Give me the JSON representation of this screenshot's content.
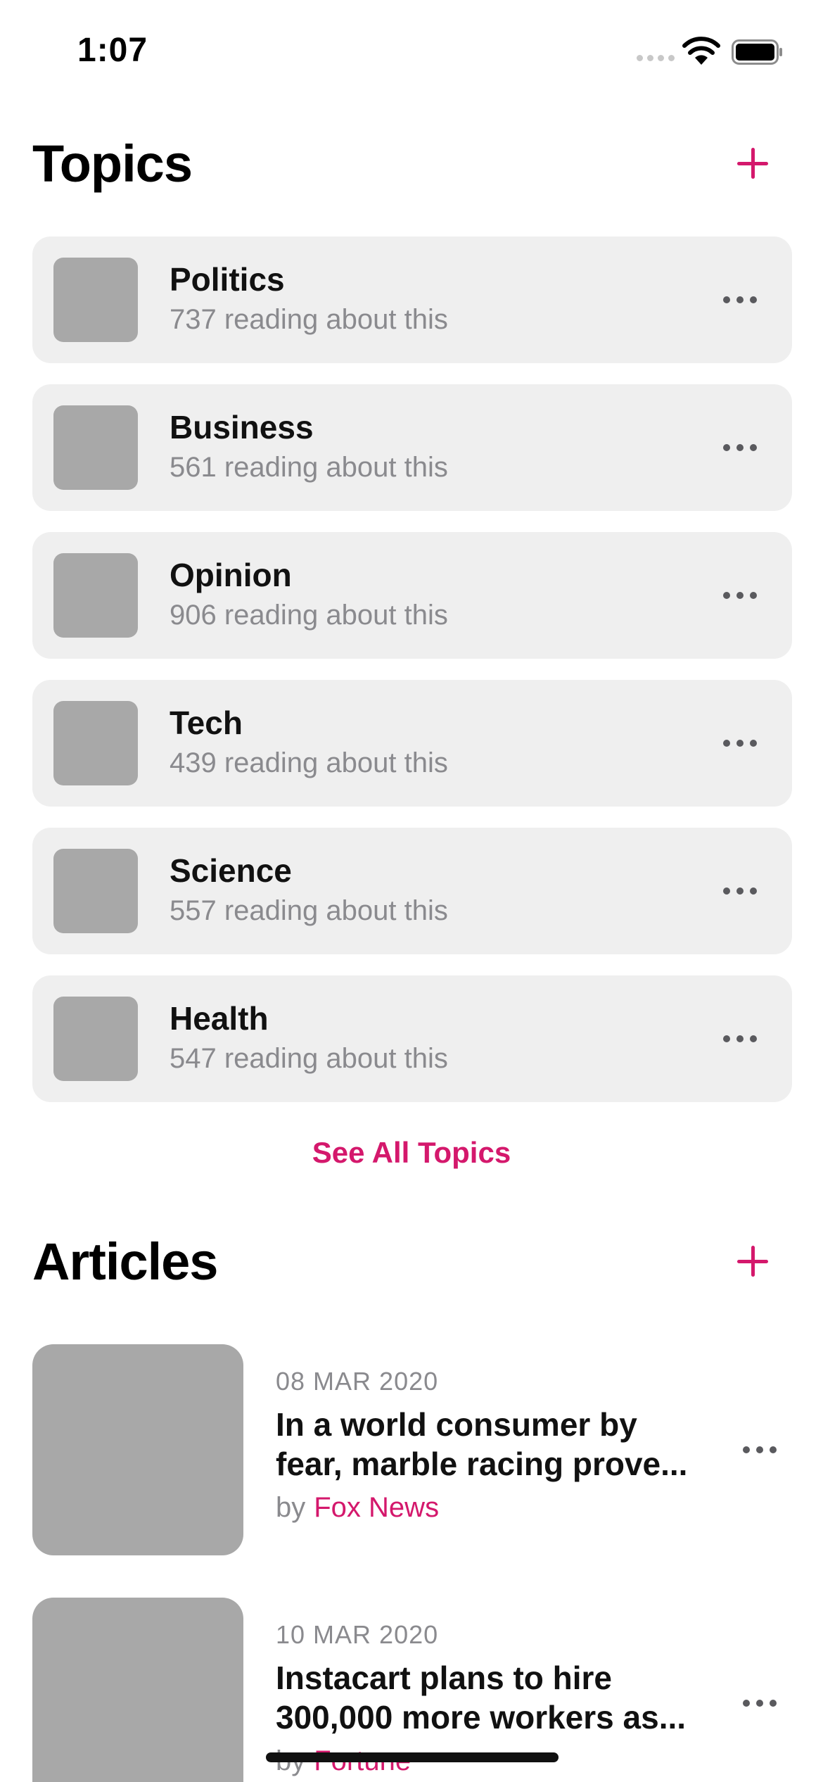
{
  "status_bar": {
    "time": "1:07"
  },
  "topics": {
    "title": "Topics",
    "items": [
      {
        "name": "Politics",
        "subtitle": "737 reading about this"
      },
      {
        "name": "Business",
        "subtitle": "561 reading about this"
      },
      {
        "name": "Opinion",
        "subtitle": "906 reading about this"
      },
      {
        "name": "Tech",
        "subtitle": "439 reading about this"
      },
      {
        "name": "Science",
        "subtitle": "557 reading about this"
      },
      {
        "name": "Health",
        "subtitle": "547 reading about this"
      }
    ],
    "see_all_label": "See All Topics"
  },
  "articles": {
    "title": "Articles",
    "items": [
      {
        "date": "08 MAR 2020",
        "title_line1": "In a world consumer by",
        "title_line2": "fear, marble racing prove...",
        "by": "by",
        "source": "Fox News"
      },
      {
        "date": "10 MAR 2020",
        "title_line1": "Instacart plans to hire",
        "title_line2": "300,000 more workers as...",
        "by": "by",
        "source": "Fortune"
      }
    ]
  },
  "colors": {
    "accent": "#d4186c",
    "card_bg": "#efefef",
    "placeholder": "#a8a8a8",
    "secondary_text": "#8a8a8e"
  },
  "icons": {
    "add": "plus-icon",
    "more": "ellipsis-icon",
    "wifi": "wifi-icon",
    "battery": "battery-icon",
    "signal": "cellular-signal-icon"
  }
}
